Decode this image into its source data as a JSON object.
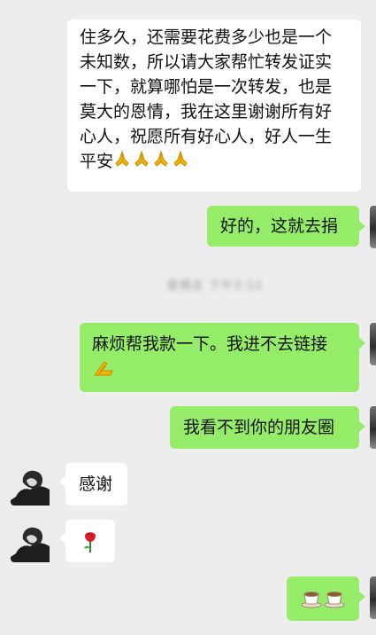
{
  "chat": {
    "messages": [
      {
        "side": "left",
        "lines": [
          "住多久，还需要花费多少也是一个",
          "未知数，所以请大家帮忙转发证实",
          "一下，就算哪怕是一次转发，也是",
          "莫大的恩情，我在这里谢谢所有好",
          "心人，祝愿所有好心人，好人一生",
          "平安"
        ],
        "trailing_emojis": [
          "folded-hands",
          "folded-hands",
          "folded-hands",
          "folded-hands"
        ]
      },
      {
        "side": "right",
        "text": "好的，这就去捐"
      },
      {
        "side": "system",
        "text": "星期五 下午3:12"
      },
      {
        "side": "right",
        "text": "麻烦帮我款一下。我进不去链接",
        "trailing_emojis": [
          "folded-hands"
        ]
      },
      {
        "side": "right",
        "text": "我看不到你的朋友圈"
      },
      {
        "side": "left",
        "text": "感谢"
      },
      {
        "side": "left",
        "emojis": [
          "rose"
        ]
      },
      {
        "side": "right",
        "emojis": [
          "coffee-cup",
          "coffee-cup"
        ]
      }
    ]
  },
  "colors": {
    "background": "#ededed",
    "outgoing_bubble": "#95ec69",
    "incoming_bubble": "#ffffff"
  }
}
